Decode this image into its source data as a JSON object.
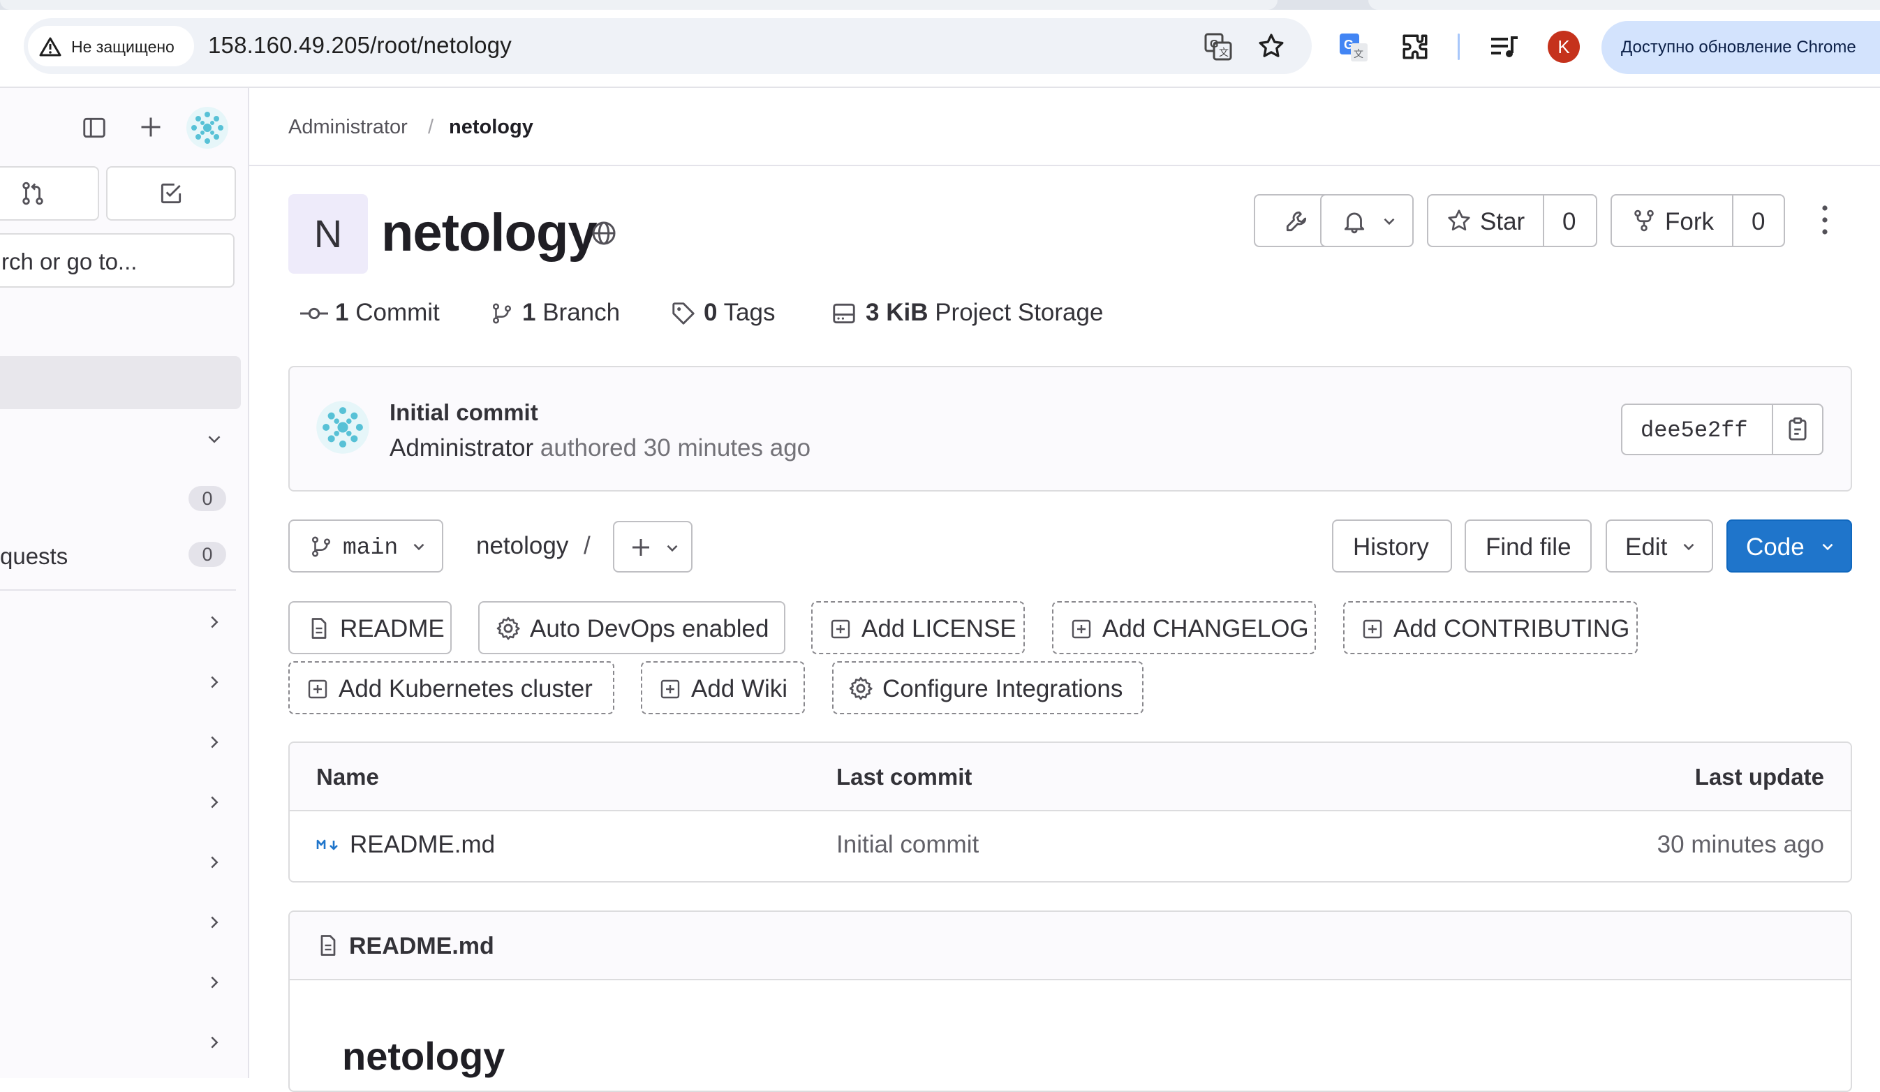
{
  "browser": {
    "security_label": "Не защищено",
    "url": "158.160.49.205/root/netology",
    "update_label": "Доступно обновление Chrome",
    "profile_initial": "K"
  },
  "sidebar": {
    "search_placeholder": "rch or go to...",
    "todo_count": "0",
    "merge_requests_label": "quests",
    "merge_requests_count": "0"
  },
  "breadcrumb": {
    "parent": "Administrator",
    "separator": "/",
    "current": "netology"
  },
  "project": {
    "avatar_letter": "N",
    "name": "netology",
    "star_label": "Star",
    "star_count": "0",
    "fork_label": "Fork",
    "fork_count": "0"
  },
  "stats": {
    "commits_count": "1",
    "commits_label": "Commit",
    "branches_count": "1",
    "branches_label": "Branch",
    "tags_count": "0",
    "tags_label": "Tags",
    "storage_size": "3 KiB",
    "storage_label": "Project Storage"
  },
  "last_commit": {
    "title": "Initial commit",
    "author": "Administrator",
    "time": "authored 30 minutes ago",
    "sha": "dee5e2ff"
  },
  "repo_nav": {
    "branch": "main",
    "path": "netology",
    "path_sep": "/",
    "history": "History",
    "find_file": "Find file",
    "edit": "Edit",
    "code": "Code"
  },
  "shortcuts": [
    "README",
    "Auto DevOps enabled",
    "Add LICENSE",
    "Add CHANGELOG",
    "Add CONTRIBUTING",
    "Add Kubernetes cluster",
    "Add Wiki",
    "Configure Integrations"
  ],
  "files": {
    "columns": [
      "Name",
      "Last commit",
      "Last update"
    ],
    "rows": [
      {
        "name": "README.md",
        "commit": "Initial commit",
        "updated": "30 minutes ago"
      }
    ]
  },
  "readme": {
    "filename": "README.md",
    "heading": "netology"
  },
  "colors": {
    "primary_button": "#1f75cb",
    "avatar_bg": "#eeebfa",
    "profile_badge": "#c5321c"
  }
}
